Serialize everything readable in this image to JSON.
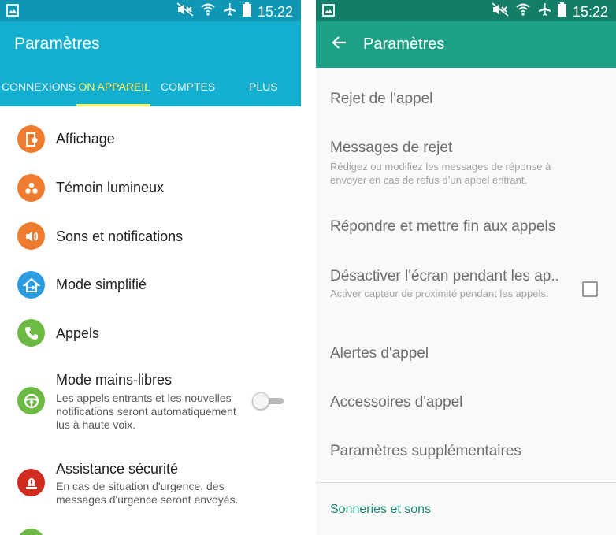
{
  "left_screen": {
    "status_bar": {
      "time": "15:22"
    },
    "title": "Paramètres",
    "tabs": [
      {
        "label": "CONNEXIONS",
        "active": false
      },
      {
        "label": "ON APPAREIL",
        "active": true
      },
      {
        "label": "COMPTES",
        "active": false
      },
      {
        "label": "PLUS",
        "active": false
      }
    ],
    "items": [
      {
        "title": "Affichage",
        "icon": "display-icon",
        "color": "#ef7c2e"
      },
      {
        "title": "Témoin lumineux",
        "icon": "led-indicator-icon",
        "color": "#ef7c2e"
      },
      {
        "title": "Sons et notifications",
        "icon": "speaker-icon",
        "color": "#ef7c2e"
      },
      {
        "title": "Mode simplifié",
        "icon": "home-icon",
        "color": "#2a9de3"
      },
      {
        "title": "Appels",
        "icon": "phone-icon",
        "color": "#6cb943"
      },
      {
        "title": "Mode mains-libres",
        "description": "Les appels entrants et les nouvelles notifications seront automatiquement lus à haute voix.",
        "icon": "steering-wheel-icon",
        "color": "#6cb943",
        "toggle_on": false
      },
      {
        "title": "Assistance sécurité",
        "description": "En cas de situation d'urgence, des messages d'urgence seront envoyés.",
        "icon": "emergency-icon",
        "color": "#d02b1e"
      }
    ]
  },
  "right_screen": {
    "status_bar": {
      "time": "15:22"
    },
    "title": "Paramètres",
    "items": [
      {
        "title": "Rejet de l'appel"
      },
      {
        "title": "Messages de rejet",
        "description": "Rédigez ou modifiez les messages de réponse à envoyer en cas de refus d’un appel entrant."
      },
      {
        "title": "Répondre et mettre fin aux appels"
      },
      {
        "title": "Désactiver l'écran pendant les ap..",
        "description": "Activer capteur de proximité pendant les appels.",
        "checked": false
      },
      {
        "title": "Alertes d'appel"
      },
      {
        "title": "Accessoires d'appel"
      },
      {
        "title": "Paramètres supplémentaires"
      }
    ],
    "section_header": "Sonneries et sons"
  },
  "colors": {
    "left_statusbar": "#0d97b5",
    "left_header": "#14aece",
    "tab_active": "#fff36a",
    "right_statusbar": "#147d68",
    "right_header": "#1da086",
    "section_accent": "#1a8a74"
  }
}
